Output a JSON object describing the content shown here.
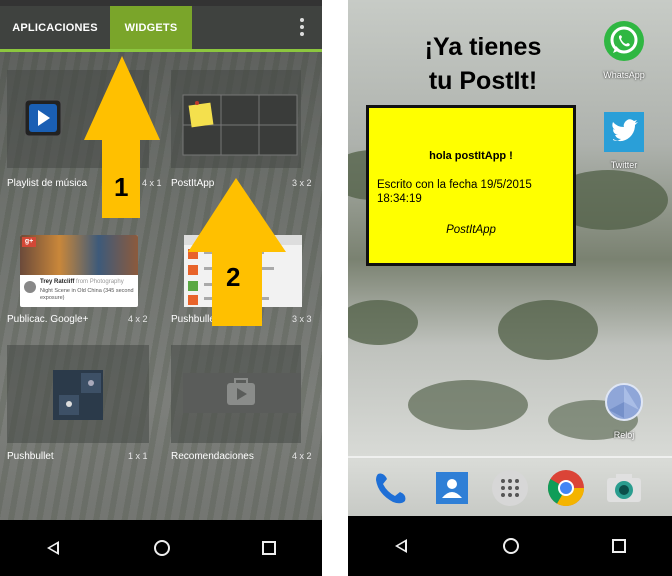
{
  "left": {
    "tabs": [
      {
        "label": "APLICACIONES",
        "active": false
      },
      {
        "label": "WIDGETS",
        "active": true
      }
    ],
    "widgets": [
      {
        "name": "Playlist de música",
        "size": "4 x 1"
      },
      {
        "name": "PostItApp",
        "size": "3 x 2"
      },
      {
        "name": "Publicac. Google+",
        "size": "4 x 2"
      },
      {
        "name": "Pushbullet",
        "size": "3 x 3"
      },
      {
        "name": "Pushbullet",
        "size": "1 x 1"
      },
      {
        "name": "Recomendaciones",
        "size": "4 x 2"
      }
    ],
    "google_plus_preview": {
      "author": "Trey Ratcliff",
      "from": "from Photography",
      "caption": "Night Scene in Old China (345 second exposure)"
    },
    "arrows": [
      {
        "label": "1",
        "color": "#ffc000"
      },
      {
        "label": "2",
        "color": "#ffc000"
      }
    ],
    "accent_color": "#8cc63f"
  },
  "right": {
    "headline_line1": "¡Ya tienes",
    "headline_line2": "tu PostIt!",
    "postit": {
      "title": "hola postItApp !",
      "body": "Escrito con la fecha 19/5/2015 18:34:19",
      "signature": "PostItApp",
      "color": "#ffff00"
    },
    "apps": [
      {
        "label": "WhatsApp",
        "icon": "whatsapp-icon"
      },
      {
        "label": "Twitter",
        "icon": "twitter-icon"
      },
      {
        "label": "Reloj",
        "icon": "clock-icon"
      }
    ],
    "dock": [
      "phone-icon",
      "contacts-icon",
      "app-drawer-icon",
      "chrome-icon",
      "camera-icon"
    ]
  },
  "navbar": [
    "back-icon",
    "home-icon",
    "recents-icon"
  ]
}
